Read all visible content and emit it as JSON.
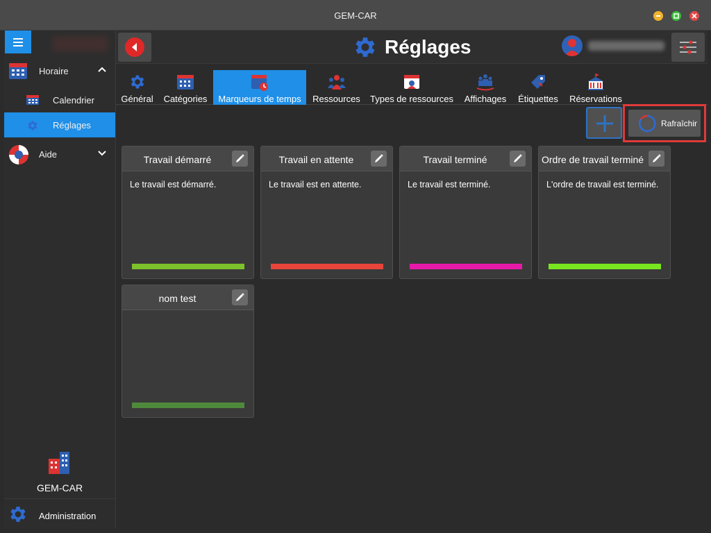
{
  "window": {
    "title": "GEM-CAR"
  },
  "sidebar": {
    "groups": [
      {
        "label": "Horaire",
        "icon": "calendar-grid-icon",
        "expanded": true
      },
      {
        "label": "Aide",
        "icon": "lifebuoy-icon",
        "expanded": false
      }
    ],
    "items": [
      {
        "label": "Calendrier",
        "icon": "calendar-small-icon",
        "active": false
      },
      {
        "label": "Réglages",
        "icon": "gear-small-icon",
        "active": true
      }
    ],
    "brand": {
      "label": "GEM-CAR",
      "icon": "buildings-icon"
    },
    "admin": {
      "label": "Administration",
      "icon": "gear-icon"
    }
  },
  "header": {
    "title": "Réglages"
  },
  "tabs": [
    {
      "label": "Général",
      "icon": "gear-icon",
      "active": false
    },
    {
      "label": "Catégories",
      "icon": "calendar-grid-icon",
      "active": false
    },
    {
      "label": "Marqueurs de temps",
      "icon": "calendar-clock-icon",
      "active": true
    },
    {
      "label": "Ressources",
      "icon": "people-group-icon",
      "active": false
    },
    {
      "label": "Types de ressources",
      "icon": "id-card-icon",
      "active": false
    },
    {
      "label": "Affichages",
      "icon": "display-people-icon",
      "active": false
    },
    {
      "label": "Étiquettes",
      "icon": "tag-icon",
      "active": false
    },
    {
      "label": "Réservations",
      "icon": "building-flag-icon",
      "active": false
    }
  ],
  "toolbar": {
    "refresh_label": "Rafraîchir"
  },
  "cards": [
    {
      "title": "Travail démarré",
      "description": "Le travail est démarré.",
      "color": "#7cc22a"
    },
    {
      "title": "Travail en attente",
      "description": "Le travail est en attente.",
      "color": "#e8443a"
    },
    {
      "title": "Travail terminé",
      "description": "Le travail est terminé.",
      "color": "#e619a8"
    },
    {
      "title": "Ordre de travail terminé",
      "description": "L'ordre de travail est terminé.",
      "color": "#78e61e"
    },
    {
      "title": "nom test",
      "description": "",
      "color": "#4f8a3c"
    }
  ],
  "colors": {
    "accent": "#1f8fe8",
    "highlight": "#e03a3a"
  }
}
